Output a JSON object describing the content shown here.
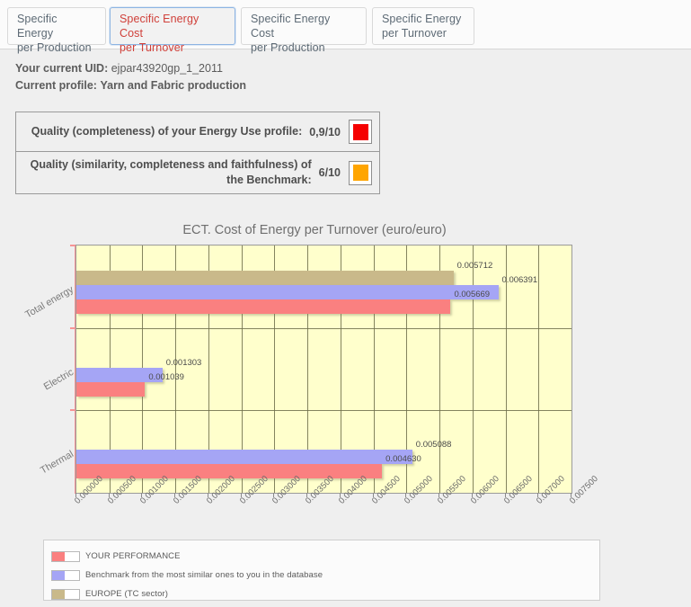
{
  "tabs": [
    {
      "label": "Specific Energy\nper Production",
      "selected": false
    },
    {
      "label": "Specific Energy Cost\nper Turnover",
      "selected": true
    },
    {
      "label": "Specific Energy Cost\nper Production",
      "selected": false
    },
    {
      "label": "Specific Energy\nper Turnover",
      "selected": false
    }
  ],
  "info": {
    "uid_label": "Your current UID:",
    "uid_value": "ejpar43920gp_1_2011",
    "profile_label": "Current profile:",
    "profile_value": "Yarn and Fabric production"
  },
  "quality": {
    "rows": [
      {
        "label": "Quality (completeness) of your Energy Use profile:",
        "score": "0,9/10",
        "color": "#f50000"
      },
      {
        "label": "Quality (similarity, completeness and faithfulness) of the Benchmark:",
        "score": "6/10",
        "color": "#ffa500"
      }
    ]
  },
  "chart_data": {
    "type": "bar",
    "orientation": "horizontal",
    "title": "ECT. Cost of Energy per Turnover (euro/euro)",
    "xlabel": "",
    "ylabel": "",
    "categories": [
      "Total energy",
      "Electric",
      "Thermal"
    ],
    "xlim": [
      0.0,
      0.0075
    ],
    "xticks": [
      "0.000000",
      "0.000500",
      "0.001000",
      "0.001500",
      "0.002000",
      "0.002500",
      "0.003000",
      "0.003500",
      "0.004000",
      "0.004500",
      "0.005000",
      "0.005500",
      "0.006000",
      "0.006500",
      "0.007000",
      "0.007500"
    ],
    "xtick_values": [
      0.0,
      0.0005,
      0.001,
      0.0015,
      0.002,
      0.0025,
      0.003,
      0.0035,
      0.004,
      0.0045,
      0.005,
      0.0055,
      0.006,
      0.0065,
      0.007,
      0.0075
    ],
    "grid": true,
    "legend_position": "below",
    "series": [
      {
        "name": "EUROPE (TC sector)",
        "color": "#c9b98a",
        "values": [
          0.005712,
          null,
          null
        ],
        "labels": [
          "0.005712",
          "",
          ""
        ]
      },
      {
        "name": "Benchmark from the most similar ones to you in the database",
        "color": "#a5a5f5",
        "values": [
          0.006391,
          0.001303,
          0.005088
        ],
        "labels": [
          "0.006391",
          "0.001303",
          "0.005088"
        ]
      },
      {
        "name": "YOUR PERFORMANCE",
        "color": "#fa8080",
        "values": [
          0.005669,
          0.001039,
          0.00463
        ],
        "labels": [
          "0.005669",
          "0.001039",
          "0.004630"
        ]
      }
    ],
    "legend": [
      {
        "name": "YOUR PERFORMANCE",
        "color": "#fa8080"
      },
      {
        "name": "Benchmark from the most similar ones to you in the database",
        "color": "#a5a5f5"
      },
      {
        "name": "EUROPE (TC sector)",
        "color": "#c9b98a"
      }
    ],
    "plot_background": "#ffffcc"
  }
}
